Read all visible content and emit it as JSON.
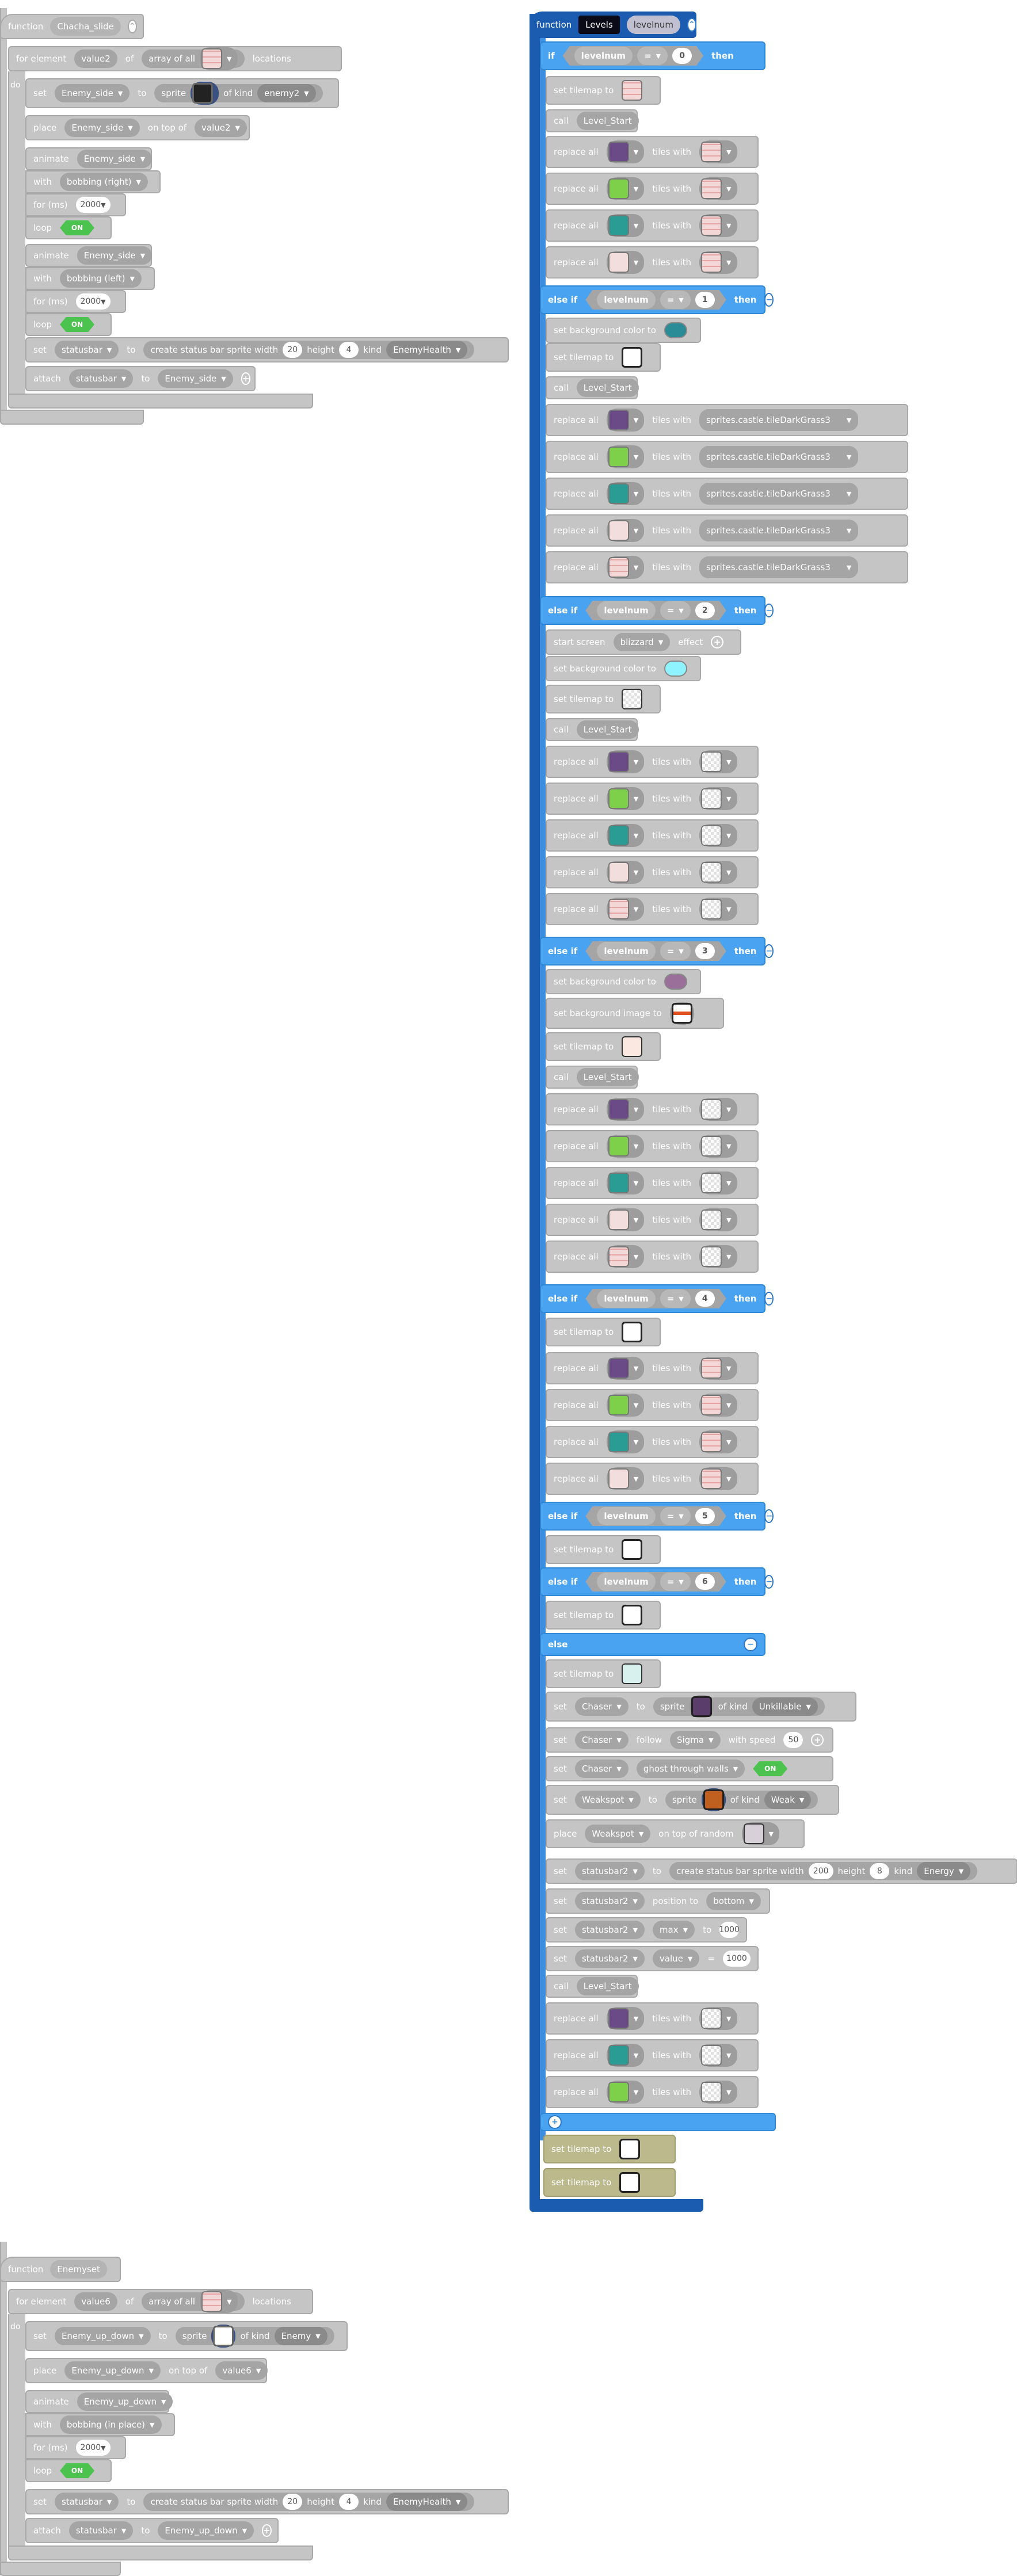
{
  "kw": {
    "function": "function",
    "for_element": "for element",
    "of": "of",
    "array_of_all": "array of all",
    "locations": "locations",
    "do": "do",
    "set": "set",
    "to": "to",
    "sprite": "sprite",
    "of_kind": "of kind",
    "place": "place",
    "on_top_of": "on top of",
    "animate": "animate",
    "with": "with",
    "for_ms": "for (ms)",
    "loop": "loop",
    "on": "ON",
    "create_status": "create status bar sprite width",
    "height": "height",
    "kind": "kind",
    "attach": "attach",
    "if": "if",
    "else_if": "else if",
    "else": "else",
    "then": "then",
    "set_tilemap": "set tilemap to",
    "call": "call",
    "replace_all": "replace all",
    "tiles_with": "tiles with",
    "set_bg_color": "set background color to",
    "set_bg_image": "set background image to",
    "start_screen": "start screen",
    "effect": "effect",
    "follow": "follow",
    "with_speed": "with speed",
    "on_top_of_random": "on top of random",
    "position_to": "position to",
    "eq": "="
  },
  "f1": {
    "name": "Chacha_slide",
    "loop_var": "value2",
    "set_var": "Enemy_side",
    "kind": "enemy2",
    "place_target": "value2",
    "anim1": "bobbing (right)",
    "anim2": "bobbing (left)",
    "ms": "2000",
    "status_var": "statusbar",
    "width": "20",
    "height": "4",
    "status_kind": "EnemyHealth"
  },
  "f2": {
    "name": "Levels",
    "param": "levelnum",
    "lv": [
      "0",
      "1",
      "2",
      "3",
      "4",
      "5",
      "6"
    ],
    "level_start": "Level_Start",
    "grass": "sprites.castle.tileDarkGrass3",
    "screen_effect": "blizzard",
    "chaser": "Chaser",
    "kind_unkillable": "Unkillable",
    "sigma": "Sigma",
    "speed": "50",
    "ghost": "ghost through walls",
    "weakspot": "Weakspot",
    "kind_weak": "Weak",
    "status2": "statusbar2",
    "width2": "200",
    "height2": "8",
    "kind_energy": "Energy",
    "pos_bottom": "bottom",
    "max": "max",
    "value": "value",
    "n1000": "1000"
  },
  "f3": {
    "name": "Enemyset",
    "loop_var": "value6",
    "set_var": "Enemy_up_down",
    "kind": "Enemy",
    "place_target": "value6",
    "anim": "bobbing (in place)",
    "ms": "2000",
    "status_var": "statusbar",
    "width": "20",
    "height": "4",
    "status_kind": "EnemyHealth"
  }
}
